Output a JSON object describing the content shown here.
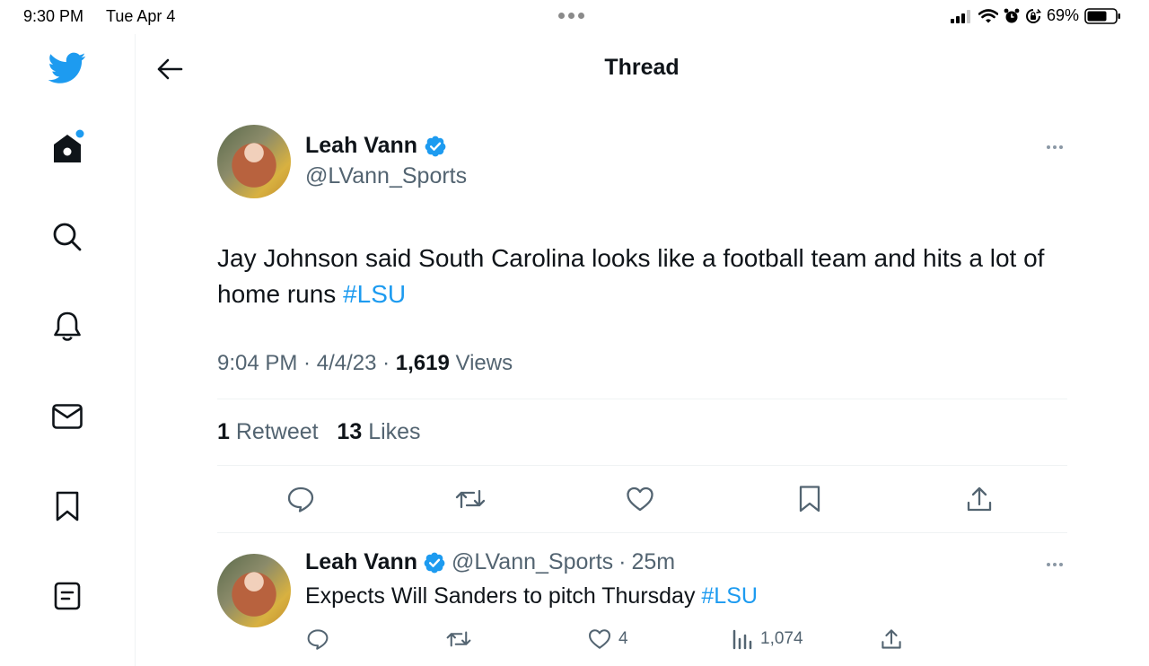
{
  "status_bar": {
    "time": "9:30 PM",
    "date": "Tue Apr 4",
    "battery": "69%"
  },
  "sidebar": {
    "items": [
      {
        "name": "twitter-logo",
        "icon": "twitter-bird-icon"
      },
      {
        "name": "home",
        "icon": "home-icon",
        "has_notification_dot": true
      },
      {
        "name": "explore",
        "icon": "search-icon"
      },
      {
        "name": "notifications",
        "icon": "bell-icon"
      },
      {
        "name": "messages",
        "icon": "mail-icon"
      },
      {
        "name": "bookmarks",
        "icon": "bookmark-icon"
      },
      {
        "name": "lists",
        "icon": "list-icon"
      }
    ]
  },
  "header": {
    "title": "Thread"
  },
  "tweet": {
    "author_name": "Leah Vann",
    "handle": "@LVann_Sports",
    "text": "Jay Johnson said South Carolina looks like a football team and hits a lot of home runs ",
    "hashtag": "#LSU",
    "time": "9:04 PM",
    "date": "4/4/23",
    "views_count": "1,619",
    "views_label": "Views",
    "retweets_count": "1",
    "retweets_label": "Retweet",
    "likes_count": "13",
    "likes_label": "Likes"
  },
  "reply": {
    "author_name": "Leah Vann",
    "handle": "@LVann_Sports",
    "age": "25m",
    "text": "Expects Will Sanders to pitch Thursday ",
    "hashtag": "#LSU",
    "likes": "4",
    "views": "1,074"
  },
  "colors": {
    "accent": "#1d9bf0",
    "secondary_text": "#536471",
    "primary_text": "#0f1419"
  }
}
